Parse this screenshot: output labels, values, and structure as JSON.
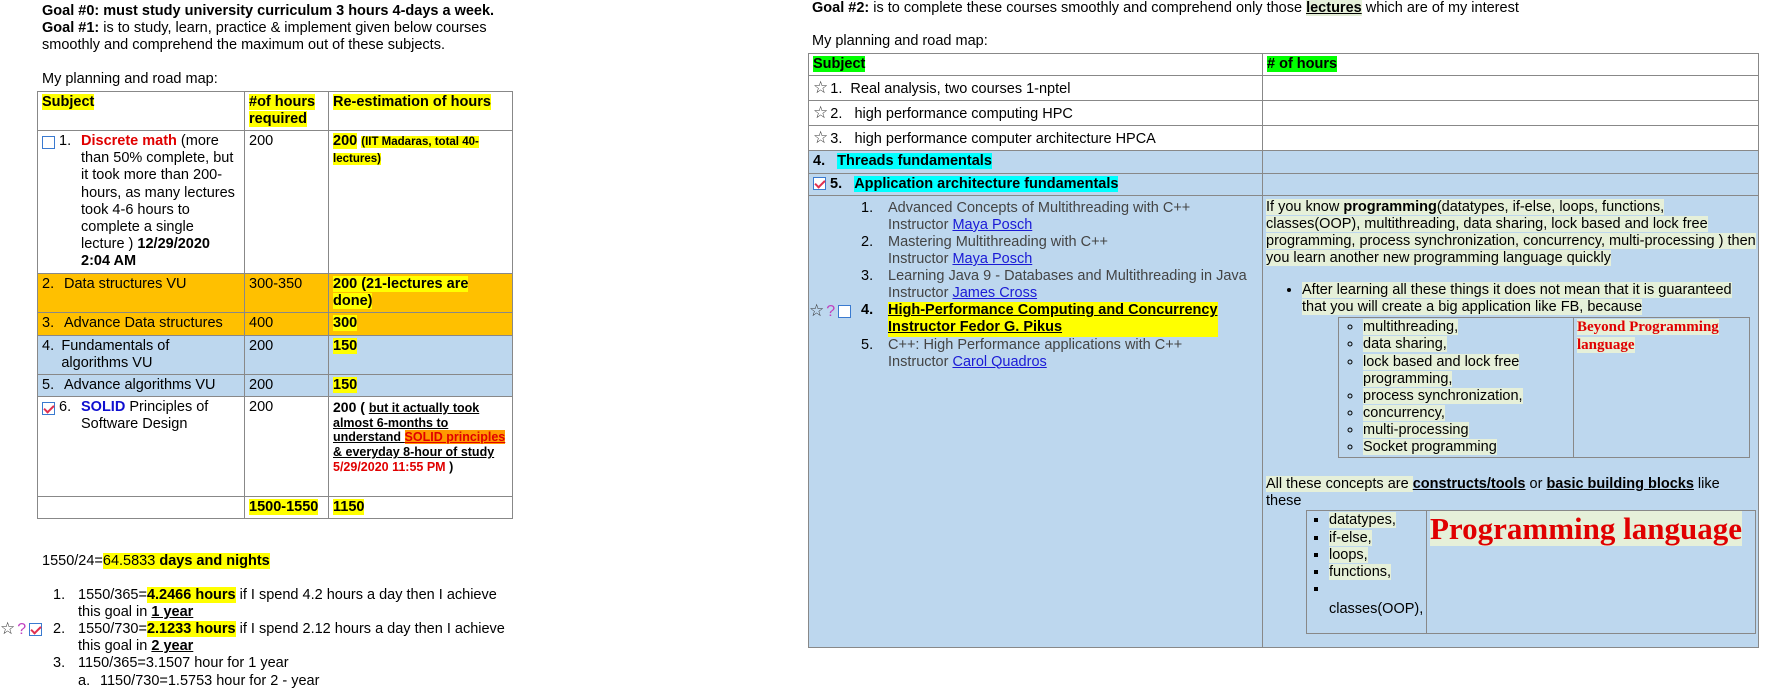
{
  "left": {
    "goal0_label": "Goal #0:",
    "goal0_text": " must study university curriculum 3 hours 4-days a week.",
    "goal1_label": "Goal #1:",
    "goal1_text": " is to study, learn, practice & implement given below courses smoothly and comprehend the maximum out of these subjects.",
    "roadmap": "My planning and road map:",
    "headers": [
      "Subject",
      "#of hours required",
      "Re-estimation of hours"
    ],
    "row1": {
      "num": "1.",
      "name": "Discrete math",
      "desc": " (more than 50% complete, but it took more than 200-hours, as many lectures took 4-6 hours to complete a single lecture ) ",
      "date": "12/29/2020 2:04 AM",
      "hours": "200",
      "re_main": "200",
      "re_note": "(IIT Madaras, total 40-lectures)"
    },
    "row2": {
      "num": "2.",
      "name": "Data structures VU",
      "hours": "300-350",
      "re": "200 (21-lectures are done)"
    },
    "row3": {
      "num": "3.",
      "name": "Advance Data structures",
      "hours": "400",
      "re": "300"
    },
    "row4": {
      "num": "4.",
      "name": "Fundamentals of algorithms VU",
      "hours": "200",
      "re": "150"
    },
    "row5": {
      "num": "5.",
      "name": "Advance algorithms VU",
      "hours": "200",
      "re": "150"
    },
    "row6": {
      "num": "6.",
      "name_blue": "SOLID",
      "name_rest": " Principles of Software Design",
      "hours": "200",
      "re_a": "200 ( ",
      "re_b": "but it actually took almost 6-months to understand ",
      "re_solid": "SOLID principles ",
      "re_c": " & everyday 8-hour of study ",
      "re_date": "5/29/2020 11:55 PM",
      "re_d": " )"
    },
    "total_hours": "1500-1550",
    "total_re": "1150",
    "calc_a": "1550/24=",
    "calc_b": "64.5833",
    "calc_c": " days and nights",
    "list": [
      {
        "num": "1.",
        "a": "1550/365=",
        "b": "4.2466 hours",
        "c": " if I spend 4.2 hours a day then I achieve this goal in ",
        "d": "1 year"
      },
      {
        "num": "2.",
        "a": "1550/730=",
        "b": "2.1233 hours",
        "c": " if I spend 2.12 hours a day then I achieve this goal in ",
        "d": "2 year"
      },
      {
        "num": "3.",
        "a": "1150/365=3.1507 hour for 1 year"
      }
    ],
    "sub_a_num": "a.",
    "sub_a": "1150/730=1.5753 hour for 2 - year"
  },
  "right": {
    "goal2_label": "Goal #2:",
    "goal2_text_a": " is to complete these courses smoothly and comprehend only those ",
    "goal2_lectures": "lectures",
    "goal2_text_b": " which are of my interest",
    "roadmap": "My planning and road map:",
    "headers": [
      "Subject",
      "# of hours"
    ],
    "rows": [
      {
        "num": "1.",
        "label": "Real analysis, two courses 1-nptel"
      },
      {
        "num": "2.",
        "label": "high performance computing HPC"
      },
      {
        "num": "3.",
        "label": "high performance computer architecture HPCA"
      }
    ],
    "row4": {
      "num": "4.",
      "label": "Threads fundamentals"
    },
    "row5": {
      "num": "5.",
      "label": "Application architecture fundamentals"
    },
    "courses": [
      {
        "num": "1.",
        "title": "Advanced Concepts of Multithreading with C++",
        "instr": "Instructor ",
        "name": "Maya Posch"
      },
      {
        "num": "2.",
        "title": "Mastering Multithreading with C++",
        "instr": "Instructor ",
        "name": "Maya Posch"
      },
      {
        "num": "3.",
        "title": "Learning Java 9 - Databases and Multithreading in Java",
        "instr": "Instructor ",
        "name": "James Cross"
      },
      {
        "num": "4.",
        "title": "High-Performance Computing and Concurrency",
        "instr": "Instructor  Fedor G. Pikus",
        "name": ""
      },
      {
        "num": "5.",
        "title": "C++: High Performance applications with C++",
        "instr": "Instructor ",
        "name": "Carol Quadros"
      }
    ],
    "para1_a": "If you know ",
    "para1_b": "programming",
    "para1_c": "(datatypes, if-else, loops, functions, classes(OOP), multithreading, data sharing, lock based and lock free programming, process synchronization, concurrency, multi-processing ) then you learn another new programming language quickly",
    "bullet": "After learning all these things it does not mean that it is guaranteed that you will create a big application like FB, because",
    "inner1_items": [
      "multithreading,",
      "data sharing,",
      "lock based and lock free programming,",
      "process synchronization,",
      "concurrency,",
      "multi-processing",
      "Socket programming"
    ],
    "beyond": "Beyond Programming language",
    "para2_a": "All these concepts are ",
    "para2_b": "constructs/tools",
    "para2_c": " or ",
    "para2_d": "basic building blocks",
    "para2_e": " like these",
    "inner2_items": [
      "datatypes,",
      " if-else,",
      "loops,",
      "functions,",
      ""
    ],
    "inner2_last": "classes(OOP),",
    "prog_lang": "Programming language"
  }
}
